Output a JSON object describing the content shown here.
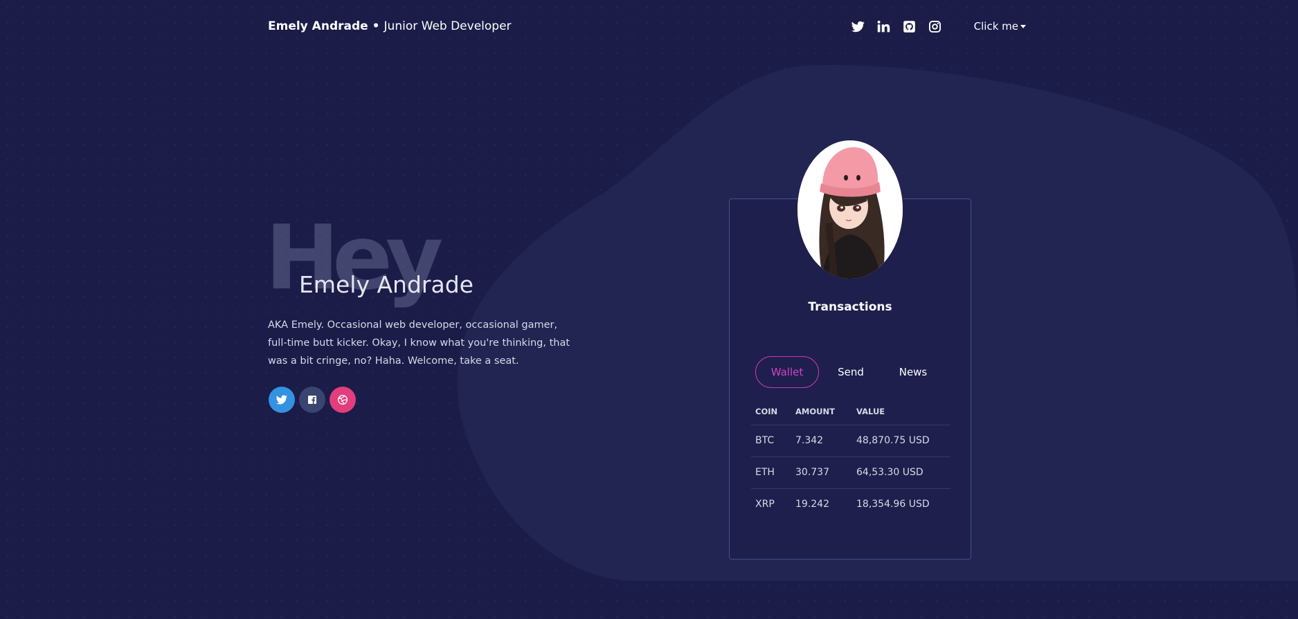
{
  "header": {
    "name": "Emely Andrade",
    "separator": "•",
    "role": "Junior Web Developer",
    "social_icons": [
      "twitter-icon",
      "linkedin-icon",
      "github-icon",
      "instagram-icon"
    ],
    "dropdown_label": "Click me"
  },
  "hero": {
    "greeting": "Hey",
    "name": "Emely Andrade",
    "bio": "AKA Emely. Occasional web developer, occasional gamer, full-time butt kicker. Okay, I know what you're thinking, that was a bit cringe, no? Haha. Welcome, take a seat.",
    "social_buttons": [
      {
        "icon": "twitter-icon",
        "color": "#3492e0"
      },
      {
        "icon": "facebook-icon",
        "color": "#394471"
      },
      {
        "icon": "dribbble-icon",
        "color": "#e23d7d"
      }
    ]
  },
  "card": {
    "title": "Transactions",
    "tabs": [
      "Wallet",
      "Send",
      "News"
    ],
    "active_tab": "Wallet",
    "columns": [
      "COIN",
      "AMOUNT",
      "VALUE"
    ],
    "rows": [
      [
        "BTC",
        "7.342",
        "48,870.75 USD"
      ],
      [
        "ETH",
        "30.737",
        "64,53.30 USD"
      ],
      [
        "XRP",
        "19.242",
        "18,354.96 USD"
      ]
    ]
  },
  "colors": {
    "background": "#1b1c48",
    "accent": "#d243c4",
    "card_border": "#474f8c"
  }
}
